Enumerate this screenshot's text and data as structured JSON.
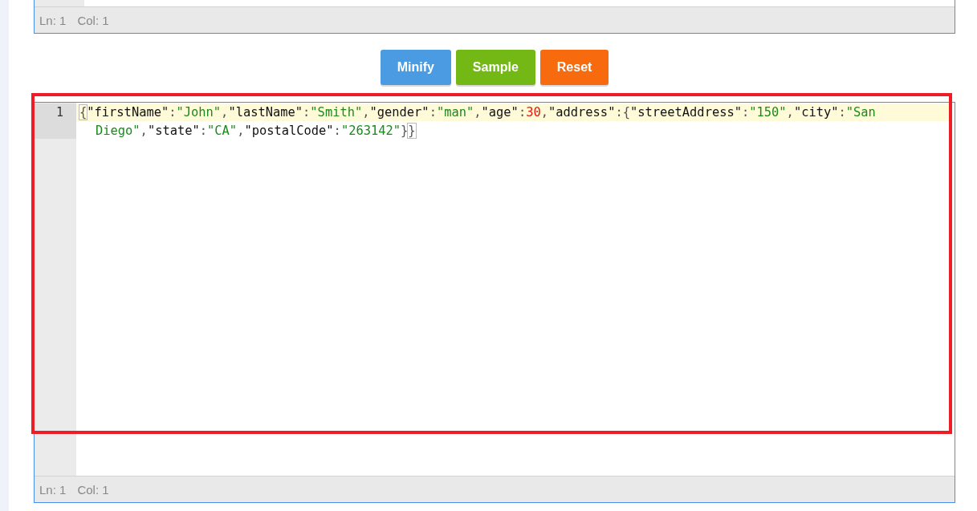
{
  "editors": [
    {
      "highlighted": false,
      "status": {
        "line": "Ln: 1",
        "column": "Col: 1"
      }
    },
    {
      "highlighted": true,
      "lines": [
        {
          "number": "1",
          "active": true,
          "tokens": [
            {
              "kind": "punct",
              "text": "{",
              "matched": true
            },
            {
              "kind": "key",
              "text": "\"firstName\""
            },
            {
              "kind": "punct",
              "text": ":"
            },
            {
              "kind": "string",
              "text": "\"John\""
            },
            {
              "kind": "punct",
              "text": ","
            },
            {
              "kind": "key",
              "text": "\"lastName\""
            },
            {
              "kind": "punct",
              "text": ":"
            },
            {
              "kind": "string",
              "text": "\"Smith\""
            },
            {
              "kind": "punct",
              "text": ","
            },
            {
              "kind": "key",
              "text": "\"gender\""
            },
            {
              "kind": "punct",
              "text": ":"
            },
            {
              "kind": "string",
              "text": "\"man\""
            },
            {
              "kind": "punct",
              "text": ","
            },
            {
              "kind": "key",
              "text": "\"age\""
            },
            {
              "kind": "punct",
              "text": ":"
            },
            {
              "kind": "number",
              "text": "30"
            },
            {
              "kind": "punct",
              "text": ","
            },
            {
              "kind": "key",
              "text": "\"address\""
            },
            {
              "kind": "punct",
              "text": ":"
            },
            {
              "kind": "punct",
              "text": "{"
            },
            {
              "kind": "key",
              "text": "\"streetAddress\""
            },
            {
              "kind": "punct",
              "text": ":"
            },
            {
              "kind": "string",
              "text": "\"150\""
            },
            {
              "kind": "punct",
              "text": ","
            },
            {
              "kind": "key",
              "text": "\"city\""
            },
            {
              "kind": "punct",
              "text": ":"
            },
            {
              "kind": "string",
              "text": "\"San Diego\""
            },
            {
              "kind": "punct",
              "text": ","
            },
            {
              "kind": "key",
              "text": "\"state\""
            },
            {
              "kind": "punct",
              "text": ":"
            },
            {
              "kind": "string",
              "text": "\"CA\""
            },
            {
              "kind": "punct",
              "text": ","
            },
            {
              "kind": "key",
              "text": "\"postalCode\""
            },
            {
              "kind": "punct",
              "text": ":"
            },
            {
              "kind": "string",
              "text": "\"263142\""
            },
            {
              "kind": "punct",
              "text": "}"
            },
            {
              "kind": "punct",
              "text": "}",
              "matched": true
            }
          ]
        }
      ],
      "status": {
        "line": "Ln: 1",
        "column": "Col: 1"
      }
    }
  ],
  "buttons": [
    {
      "label": "Minify",
      "color": "#4a9be2"
    },
    {
      "label": "Sample",
      "color": "#74b816"
    },
    {
      "label": "Reset",
      "color": "#f76b0e"
    }
  ]
}
